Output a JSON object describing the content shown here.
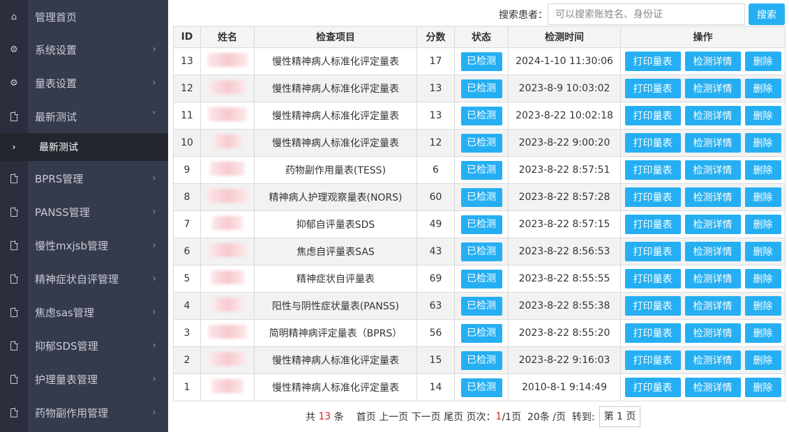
{
  "sidebar": {
    "items": [
      {
        "label": "管理首页",
        "icon": "home-icon",
        "chevron": false
      },
      {
        "label": "系统设置",
        "icon": "gear-icon",
        "chevron": true
      },
      {
        "label": "量表设置",
        "icon": "gear-icon",
        "chevron": true
      },
      {
        "label": "最新测试",
        "icon": "file-icon",
        "chevron": true,
        "expanded": true
      },
      {
        "label": "BPRS管理",
        "icon": "file-icon",
        "chevron": true
      },
      {
        "label": "PANSS管理",
        "icon": "file-icon",
        "chevron": true
      },
      {
        "label": "慢性mxjsb管理",
        "icon": "file-icon",
        "chevron": true
      },
      {
        "label": "精神症状自评管理",
        "icon": "file-icon",
        "chevron": true
      },
      {
        "label": "焦虑sas管理",
        "icon": "file-icon",
        "chevron": true
      },
      {
        "label": "抑郁SDS管理",
        "icon": "file-icon",
        "chevron": true
      },
      {
        "label": "护理量表管理",
        "icon": "file-icon",
        "chevron": true
      },
      {
        "label": "药物副作用管理",
        "icon": "file-icon",
        "chevron": true
      }
    ],
    "sub_item": {
      "label": "最新测试",
      "icon": "chevron-right-icon"
    }
  },
  "search": {
    "label": "搜索患者：",
    "placeholder": "可以搜索账姓名、身份证",
    "button": "搜索"
  },
  "table": {
    "headers": [
      "ID",
      "姓名",
      "检查项目",
      "分数",
      "状态",
      "检测时间",
      "操作"
    ],
    "ops": {
      "print": "打印量表",
      "detail": "检测详情",
      "delete": "删除"
    },
    "rows": [
      {
        "id": "13",
        "item": "慢性精神病人标准化评定量表",
        "score": "17",
        "status": "已检测",
        "time": "2024-1-10 11:30:06"
      },
      {
        "id": "12",
        "item": "慢性精神病人标准化评定量表",
        "score": "13",
        "status": "已检测",
        "time": "2023-8-9 10:03:02"
      },
      {
        "id": "11",
        "item": "慢性精神病人标准化评定量表",
        "score": "13",
        "status": "已检测",
        "time": "2023-8-22 10:02:18"
      },
      {
        "id": "10",
        "item": "慢性精神病人标准化评定量表",
        "score": "12",
        "status": "已检测",
        "time": "2023-8-22 9:00:20"
      },
      {
        "id": "9",
        "item": "药物副作用量表(TESS)",
        "score": "6",
        "status": "已检测",
        "time": "2023-8-22 8:57:51"
      },
      {
        "id": "8",
        "item": "精神病人护理观察量表(NORS)",
        "score": "60",
        "status": "已检测",
        "time": "2023-8-22 8:57:28"
      },
      {
        "id": "7",
        "item": "抑郁自评量表SDS",
        "score": "49",
        "status": "已检测",
        "time": "2023-8-22 8:57:15"
      },
      {
        "id": "6",
        "item": "焦虑自评量表SAS",
        "score": "43",
        "status": "已检测",
        "time": "2023-8-22 8:56:53"
      },
      {
        "id": "5",
        "item": "精神症状自评量表",
        "score": "69",
        "status": "已检测",
        "time": "2023-8-22 8:55:55"
      },
      {
        "id": "4",
        "item": "阳性与阴性症状量表(PANSS)",
        "score": "63",
        "status": "已检测",
        "time": "2023-8-22 8:55:38"
      },
      {
        "id": "3",
        "item": "简明精神病评定量表（BPRS）",
        "score": "56",
        "status": "已检测",
        "time": "2023-8-22 8:55:20"
      },
      {
        "id": "2",
        "item": "慢性精神病人标准化评定量表",
        "score": "15",
        "status": "已检测",
        "time": "2023-8-22 9:16:03"
      },
      {
        "id": "1",
        "item": "慢性精神病人标准化评定量表",
        "score": "14",
        "status": "已检测",
        "time": "2010-8-1 9:14:49"
      }
    ]
  },
  "pager": {
    "total_prefix": "共",
    "total": "13",
    "total_suffix": "条",
    "first": "首页",
    "prev": "上一页",
    "next": "下一页",
    "last": "尾页",
    "page_label": "页次：",
    "current": "1",
    "pages": "/1页",
    "per_page": "20条 /页",
    "goto": "转到:",
    "goto_value": "第 1 页"
  },
  "colors": {
    "accent": "#25aff2",
    "sidebar": "#353a4c",
    "sidebar_icons": "#2b2f3d",
    "active_sub": "#23262f"
  }
}
